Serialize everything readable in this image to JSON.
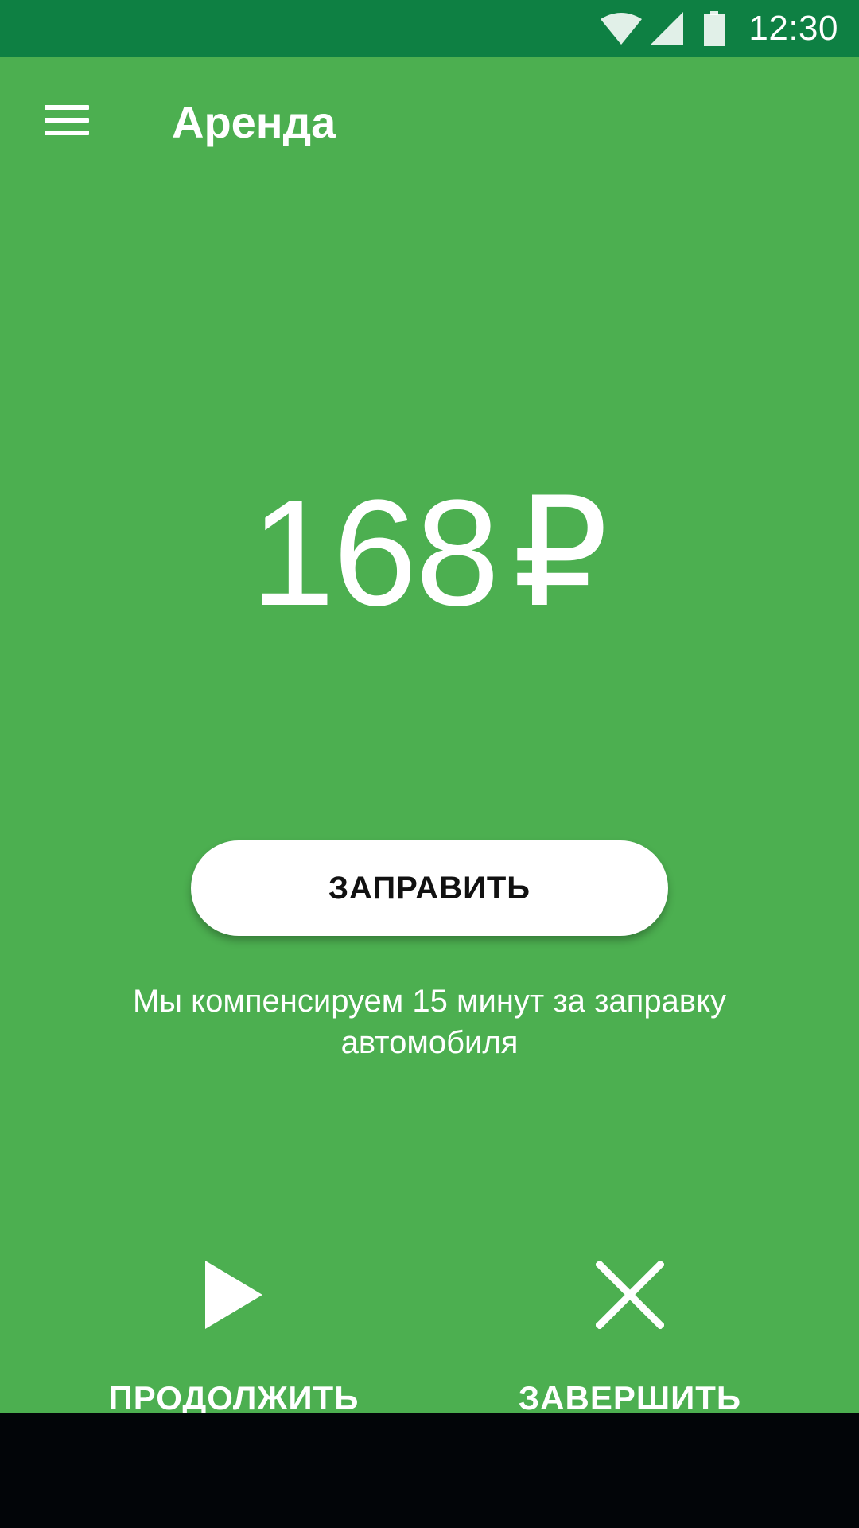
{
  "status_bar": {
    "time": "12:30",
    "icons": [
      "wifi-icon",
      "signal-icon",
      "battery-icon"
    ],
    "background": "#0E8043"
  },
  "toolbar": {
    "title": "Аренда",
    "menu_icon": "menu-icon"
  },
  "rental": {
    "amount": "168",
    "currency": "₽"
  },
  "refuel": {
    "button_label": "ЗАПРАВИТЬ",
    "note": "Мы компенсируем 15 минут за заправку автомобиля"
  },
  "actions": {
    "continue_label": "ПРОДОЛЖИТЬ",
    "continue_icon": "play-icon",
    "finish_label": "ЗАВЕРШИТЬ",
    "finish_icon": "close-icon"
  },
  "colors": {
    "primary": "#4CAF50",
    "primary_dark": "#0E8043",
    "text_on_primary": "#FFFFFF",
    "button_background": "#FFFFFF",
    "button_text": "#111111",
    "nav_bar": "#020508"
  }
}
